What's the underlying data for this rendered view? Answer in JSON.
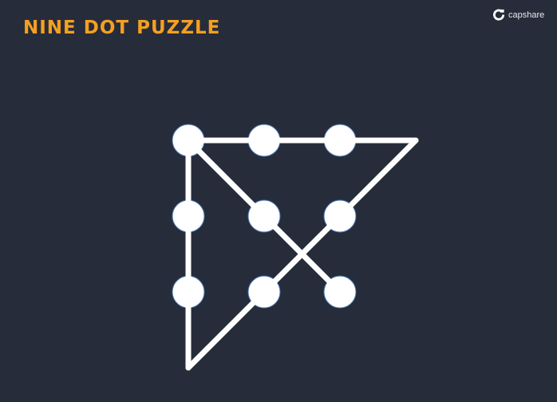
{
  "title": "NINE DOT PUZZLE",
  "brand": {
    "name": "capshare",
    "icon": "capshare-logo-icon"
  },
  "colors": {
    "background": "#272c3a",
    "title": "#f5a020",
    "dot": "#ffffff",
    "line": "#ffffff"
  },
  "puzzle": {
    "grid": [
      3,
      3
    ],
    "solution_path": [
      [
        2,
        2
      ],
      [
        0,
        0
      ],
      [
        3,
        0
      ],
      [
        0,
        3
      ],
      [
        0,
        0
      ]
    ]
  }
}
